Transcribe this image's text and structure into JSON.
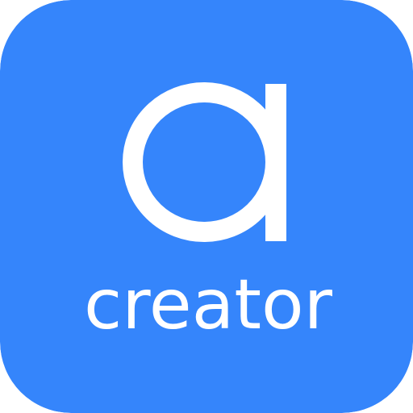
{
  "icon": {
    "glyph": "a",
    "label": "creator",
    "background_color": "#3585fb",
    "foreground_color": "#ffffff",
    "glyph_icon_name": "letter-a-logo-icon"
  }
}
